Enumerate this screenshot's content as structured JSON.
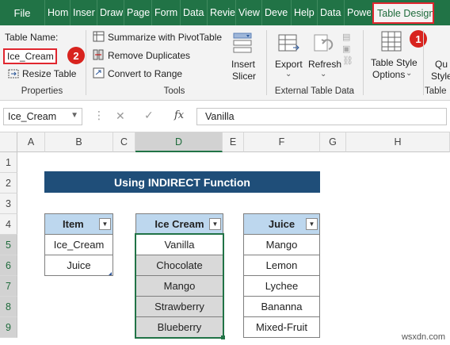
{
  "ribbon_tabs": {
    "file": "File",
    "items": [
      "Hom",
      "Inser",
      "Draw",
      "Page",
      "Form",
      "Data",
      "Revie",
      "View",
      "Deve",
      "Help",
      "Data",
      "Powe"
    ],
    "active": "Table Design"
  },
  "ribbon": {
    "properties": {
      "table_name_label": "Table Name:",
      "table_name_value": "Ice_Cream",
      "resize": "Resize Table",
      "group": "Properties"
    },
    "tools": {
      "summarize": "Summarize with PivotTable",
      "remove_duplicates": "Remove Duplicates",
      "convert": "Convert to Range",
      "insert_slicer_1": "Insert",
      "insert_slicer_2": "Slicer",
      "group": "Tools"
    },
    "external": {
      "export": "Export",
      "refresh": "Refresh",
      "group": "External Table Data"
    },
    "style_options": {
      "label_1": "Table Style",
      "label_2": "Options",
      "quick_1": "Qu",
      "quick_2": "Style",
      "group_partial": "Table"
    },
    "badges": [
      "1",
      "2"
    ]
  },
  "formula_bar": {
    "name_box": "Ice_Cream",
    "fx": "fx",
    "content": "Vanilla"
  },
  "columns": [
    "A",
    "B",
    "C",
    "D",
    "E",
    "F",
    "G",
    "H"
  ],
  "rows": [
    "1",
    "2",
    "3",
    "4",
    "5",
    "6",
    "7",
    "8",
    "9"
  ],
  "sheet": {
    "title": "Using INDIRECT Function",
    "item_table": {
      "header": "Item",
      "values": [
        "Ice_Cream",
        "Juice"
      ]
    },
    "icecream_table": {
      "header": "Ice Cream",
      "values": [
        "Vanilla",
        "Chocolate",
        "Mango",
        "Strawberry",
        "Blueberry"
      ]
    },
    "juice_table": {
      "header": "Juice",
      "values": [
        "Mango",
        "Lemon",
        "Lychee",
        "Bananna",
        "Mixed-Fruit"
      ]
    }
  },
  "watermark": "wsxdn.com",
  "colors": {
    "excel_green": "#217346",
    "title_fill": "#1f4e79",
    "header_fill": "#bdd7ee",
    "badge_red": "#d8231e"
  }
}
